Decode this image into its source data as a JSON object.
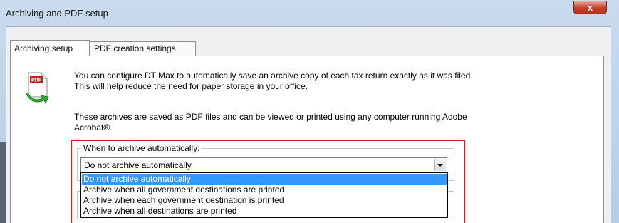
{
  "window": {
    "title": "Archiving and PDF setup",
    "close_label": "x"
  },
  "tabs": [
    {
      "label": "Archiving setup",
      "active": true
    },
    {
      "label": "PDF creation settings",
      "active": false
    }
  ],
  "icon": {
    "name": "pdf-archive-icon",
    "badge": "PDF"
  },
  "paragraphs": {
    "intro": "You can configure DT Max to automatically save an archive copy of each tax return exactly as it was filed. This will help reduce the need for paper storage in your office.",
    "acrobat": "These archives are saved as PDF files and can be viewed or printed using any computer running Adobe Acrobat®."
  },
  "archive_group": {
    "legend": "When to archive automatically:",
    "selected": "Do not archive automatically",
    "options": [
      "Do not archive automatically",
      "Archive when all government destinations are printed",
      "Archive when each government destination is printed",
      "Archive when all destinations are printed"
    ],
    "highlighted_index": 0
  },
  "colors": {
    "highlight": "#3399ff",
    "focus_box": "#e21a1a",
    "close_button": "#c7432c"
  }
}
